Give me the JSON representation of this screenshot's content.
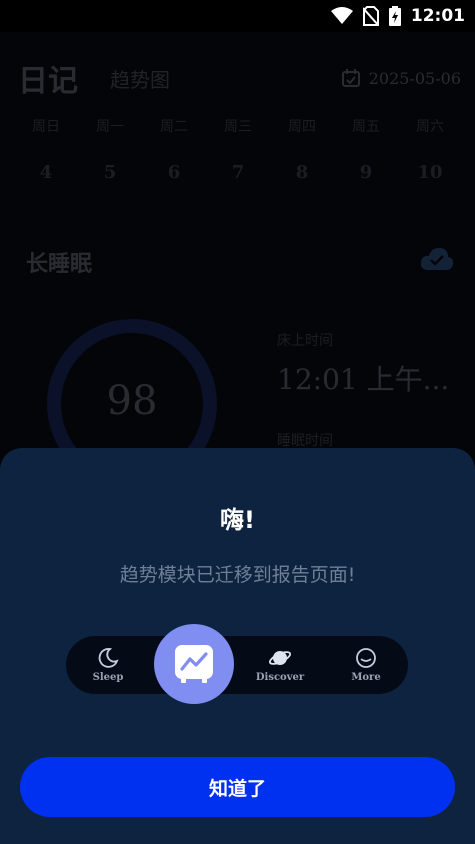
{
  "status_bar": {
    "time": "12:01"
  },
  "header": {
    "title": "日记",
    "tab_trend": "趋势图",
    "date": "2025-05-06"
  },
  "week": {
    "days": [
      "周日",
      "周一",
      "周二",
      "周三",
      "周四",
      "周五",
      "周六"
    ],
    "dates": [
      "4",
      "5",
      "6",
      "7",
      "8",
      "9",
      "10"
    ]
  },
  "sleep": {
    "title": "长睡眠",
    "score": "98",
    "score_fraction": 0.98,
    "bed_label": "床上时间",
    "bed_time": "12:01 上午...",
    "sleep_label": "睡眠时间"
  },
  "modal": {
    "greeting": "嗨!",
    "message": "趋势模块已迁移到报告页面!",
    "ok_label": "知道了"
  },
  "nav": {
    "sleep": "Sleep",
    "discover": "Discover",
    "more": "More"
  },
  "colors": {
    "sheet_bg": "#0e2340",
    "button_bg": "#0031f0",
    "center_bg": "#7f8ef0",
    "nav_bg": "#050b16"
  }
}
